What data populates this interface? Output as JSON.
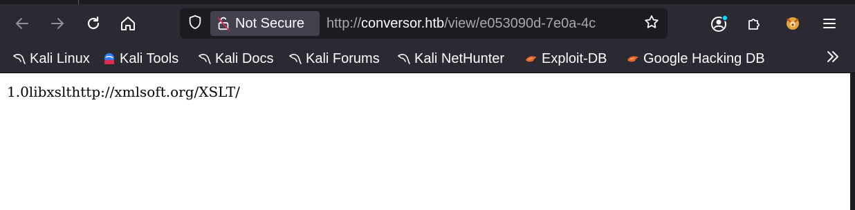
{
  "toolbar": {
    "back_icon": "arrow-left-icon",
    "forward_icon": "arrow-right-icon",
    "reload_icon": "reload-icon",
    "home_icon": "home-icon"
  },
  "urlbar": {
    "security_label": "Not Secure",
    "url_scheme": "http://",
    "url_host": "conversor.htb",
    "url_path": "/view/e053090d-7e0a-4c",
    "bookmark_star_icon": "star-icon"
  },
  "bookmarks": {
    "items": [
      {
        "label": "Kali Linux",
        "icon": "kali-dragon-icon"
      },
      {
        "label": "Kali Tools",
        "icon": "kali-tools-icon"
      },
      {
        "label": "Kali Docs",
        "icon": "kali-dragon-icon"
      },
      {
        "label": "Kali Forums",
        "icon": "kali-dragon-icon"
      },
      {
        "label": "Kali NetHunter",
        "icon": "kali-dragon-icon"
      },
      {
        "label": "Exploit-DB",
        "icon": "exploit-db-icon"
      },
      {
        "label": "Google Hacking DB",
        "icon": "exploit-db-icon"
      }
    ],
    "overflow_icon": "chevron-double-right-icon"
  },
  "page": {
    "body_text": "1.0libxslthttp://xmlsoft.org/XSLT/"
  },
  "colors": {
    "toolbar_bg": "#2b2a33",
    "urlbar_bg": "#1c1b22",
    "not_secure_bg": "#42414d",
    "text_light": "#fbfbfe",
    "url_dim": "#a8a8b0",
    "exploit_orange": "#e8662a",
    "account_badge": "#00ddff"
  }
}
